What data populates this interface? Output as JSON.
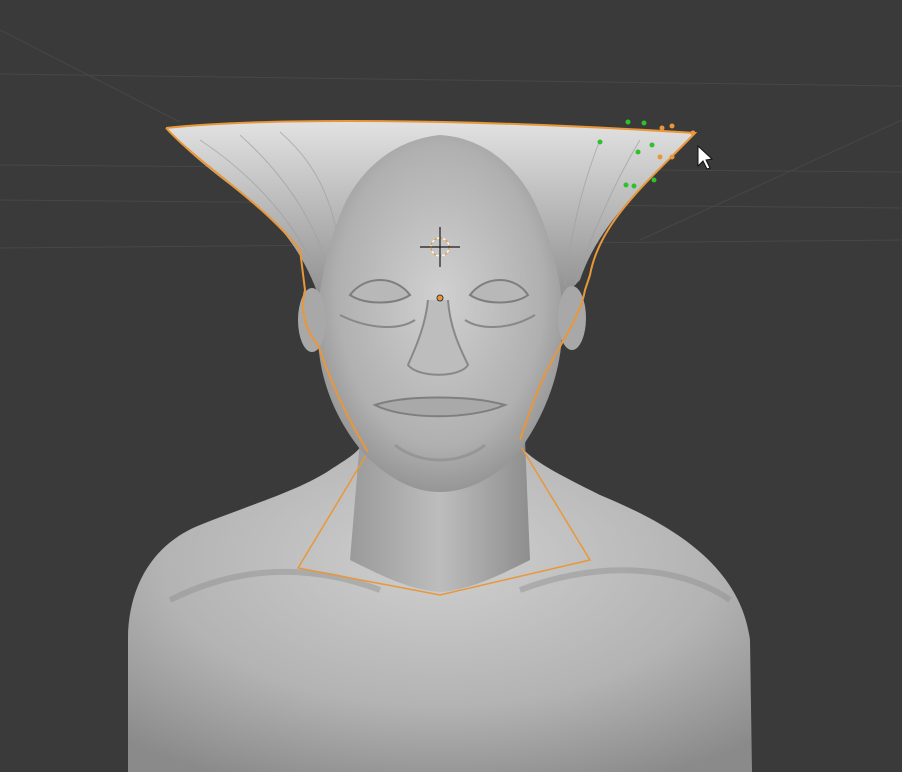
{
  "app": {
    "view": "3d-viewport",
    "mode": "sculpt"
  },
  "colors": {
    "background": "#3a3a3a",
    "grid": "#4a4a4a",
    "mesh": "#a9a9a9",
    "mesh_dark": "#7c7c7c",
    "mesh_light": "#cdcdcd",
    "selection_outline": "#e8973a",
    "control_point": "#2fbf2f",
    "origin": "#e8973a"
  },
  "icons": {
    "cursor": "arrow-cursor-icon",
    "3d_cursor": "crosshair-icon",
    "origin": "object-origin-icon"
  }
}
